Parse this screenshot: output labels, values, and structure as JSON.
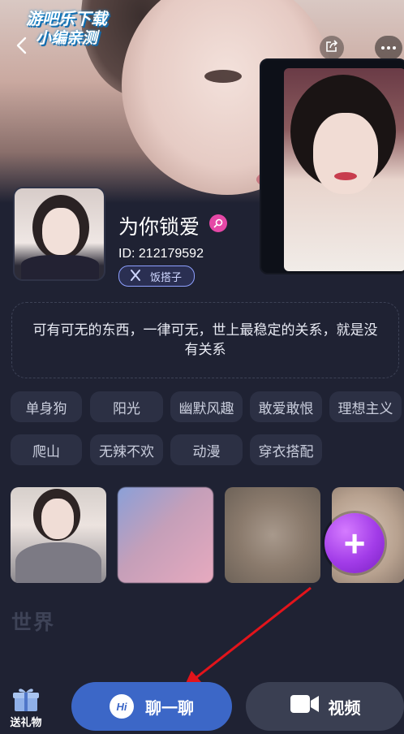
{
  "watermark": {
    "line1": "游吧乐下载",
    "line2": "小编亲测"
  },
  "profile": {
    "name": "为你锁爱",
    "id_text": "ID: 212179592",
    "tag_label": "饭搭子",
    "bio": "可有可无的东西，一律可无，世上最稳定的关系，就是没有关系"
  },
  "tags": [
    "单身狗",
    "阳光",
    "幽默风趣",
    "敢爱敢恨",
    "理想主义",
    "爬山",
    "无辣不欢",
    "动漫",
    "穿衣搭配"
  ],
  "section": {
    "world_title": "世界"
  },
  "bottom_bar": {
    "gift_label": "送礼物",
    "chat_label": "聊一聊",
    "chat_icon_text": "Hi",
    "video_label": "视频"
  },
  "icons": [
    "back-arrow-icon",
    "share-icon",
    "more-icon",
    "name-badge-icon",
    "fork-knife-icon",
    "plus-icon",
    "gift-icon",
    "hi-chat-icon",
    "video-camera-icon"
  ],
  "colors": {
    "background": "#1f2233",
    "chat_button": "#3c67c7",
    "video_button": "#3a3f52",
    "tag_bg": "#2c3044",
    "add_button": "#a23ce8",
    "annotation_arrow": "#e3141b"
  }
}
